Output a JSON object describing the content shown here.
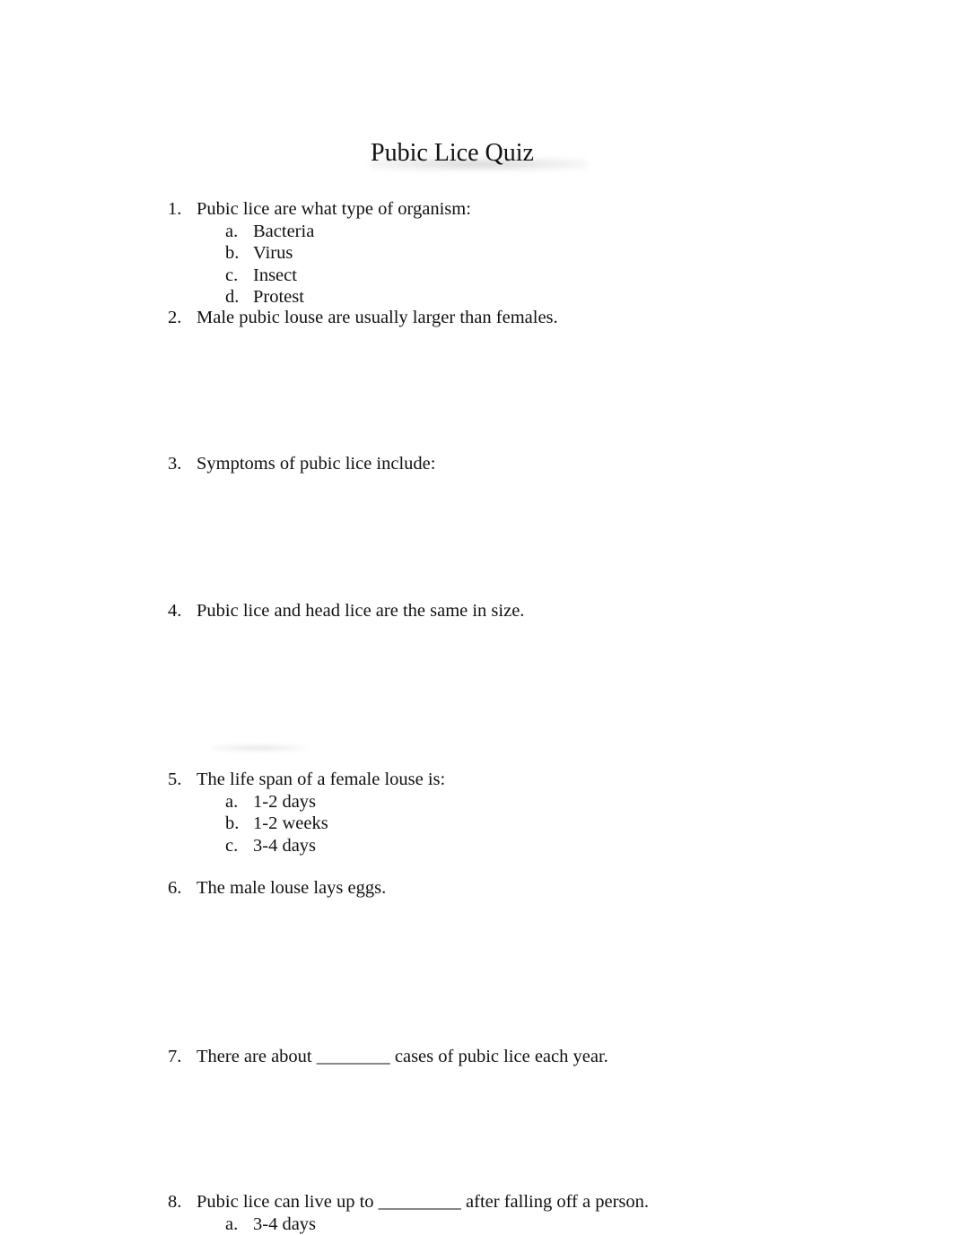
{
  "document": {
    "title": "Pubic Lice Quiz",
    "questions": [
      {
        "number": "1.",
        "text": "Pubic lice are what type of organism:",
        "options": [
          {
            "letter": "a.",
            "text": "Bacteria"
          },
          {
            "letter": "b.",
            "text": "Virus"
          },
          {
            "letter": "c.",
            "text": "Insect"
          },
          {
            "letter": "d.",
            "text": "Protest"
          }
        ]
      },
      {
        "number": "2.",
        "text": "Male pubic louse are usually larger than females."
      },
      {
        "number": "3.",
        "text": "Symptoms of pubic lice include:"
      },
      {
        "number": "4.",
        "text": "Pubic lice and head lice are the same in size."
      },
      {
        "number": "5.",
        "text": "The life span of a female louse is:",
        "options": [
          {
            "letter": "a.",
            "text": "1-2 days"
          },
          {
            "letter": "b.",
            "text": "1-2 weeks"
          },
          {
            "letter": "c.",
            "text": "3-4 days"
          }
        ]
      },
      {
        "number": "6.",
        "text": "The male louse lays eggs."
      },
      {
        "number": "7.",
        "text": "There are about ________ cases of pubic lice each year."
      },
      {
        "number": "8.",
        "text": "Pubic lice can live up to _________ after falling off a person.",
        "options": [
          {
            "letter": "a.",
            "text": "3-4 days"
          }
        ]
      }
    ]
  }
}
